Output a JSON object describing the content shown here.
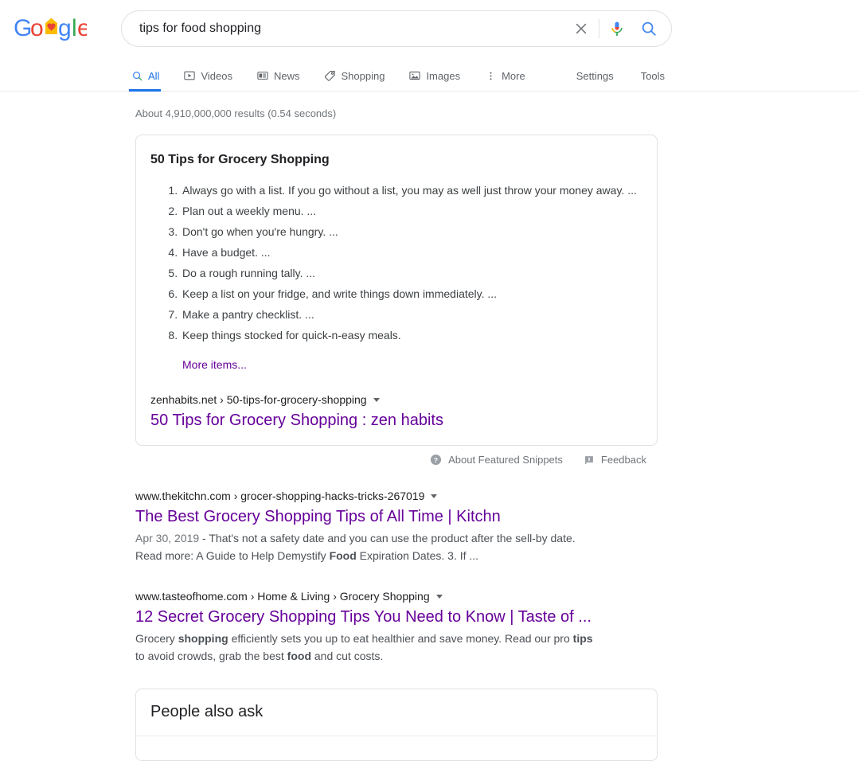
{
  "branding": {
    "logo_alt": "Google",
    "logo_letters": [
      "G",
      "o",
      "o",
      "g",
      "l",
      "e"
    ],
    "logo_doodle": "stay-home-house-with-heart",
    "colors": {
      "blue": "#4285f4",
      "red": "#ea4335",
      "yellow": "#fbbc05",
      "green": "#34a853",
      "link": "#1a0dab",
      "visited": "#660099",
      "accent": "#1a73e8",
      "muted": "#70757a"
    }
  },
  "search": {
    "query": "tips for food shopping",
    "placeholder": "Search",
    "clear_icon": "close-icon",
    "voice_icon": "microphone-icon",
    "submit_icon": "search-icon"
  },
  "nav": {
    "tabs": [
      {
        "label": "All",
        "icon": "search-icon",
        "active": true
      },
      {
        "label": "Videos",
        "icon": "video-icon",
        "active": false
      },
      {
        "label": "News",
        "icon": "news-icon",
        "active": false
      },
      {
        "label": "Shopping",
        "icon": "tag-icon",
        "active": false
      },
      {
        "label": "Images",
        "icon": "image-icon",
        "active": false
      },
      {
        "label": "More",
        "icon": "more-vertical-icon",
        "active": false
      }
    ],
    "settings_label": "Settings",
    "tools_label": "Tools"
  },
  "results_stats": "About 4,910,000,000 results (0.54 seconds)",
  "featured_snippet": {
    "title": "50 Tips for Grocery Shopping",
    "items": [
      "Always go with a list. If you go without a list, you may as well just throw your money away. ...",
      "Plan out a weekly menu. ...",
      "Don't go when you're hungry. ...",
      "Have a budget. ...",
      "Do a rough running tally. ...",
      "Keep a list on your fridge, and write things down immediately. ...",
      "Make a pantry checklist. ...",
      "Keep things stocked for quick-n-easy meals."
    ],
    "more_items_label": "More items...",
    "source": {
      "domain": "zenhabits.net",
      "path": "50-tips-for-grocery-shopping",
      "breadcrumb": "zenhabits.net › 50-tips-for-grocery-shopping",
      "title": "50 Tips for Grocery Shopping : zen habits"
    },
    "footer": {
      "about_label": "About Featured Snippets",
      "about_icon": "help-circle-icon",
      "feedback_label": "Feedback",
      "feedback_icon": "flag-icon"
    }
  },
  "results": [
    {
      "breadcrumb": "www.thekitchn.com › grocer-shopping-hacks-tricks-267019",
      "title": "The Best Grocery Shopping Tips of All Time | Kitchn",
      "visited": true,
      "date": "Apr 30, 2019",
      "description_parts": [
        {
          "text": " - That's not a safety date and you can use the product after the sell-by date. Read more: A Guide to Help Demystify ",
          "bold": false
        },
        {
          "text": "Food",
          "bold": true
        },
        {
          "text": " Expiration Dates. 3. If ...",
          "bold": false
        }
      ]
    },
    {
      "breadcrumb": "www.tasteofhome.com › Home & Living › Grocery Shopping",
      "title": "12 Secret Grocery Shopping Tips You Need to Know | Taste of ...",
      "visited": true,
      "date": "",
      "description_parts": [
        {
          "text": "Grocery ",
          "bold": false
        },
        {
          "text": "shopping",
          "bold": true
        },
        {
          "text": " efficiently sets you up to eat healthier and save money. Read our pro ",
          "bold": false
        },
        {
          "text": "tips",
          "bold": true
        },
        {
          "text": " to avoid crowds, grab the best ",
          "bold": false
        },
        {
          "text": "food",
          "bold": true
        },
        {
          "text": " and cut costs.",
          "bold": false
        }
      ]
    }
  ],
  "people_also_ask": {
    "heading": "People also ask"
  }
}
